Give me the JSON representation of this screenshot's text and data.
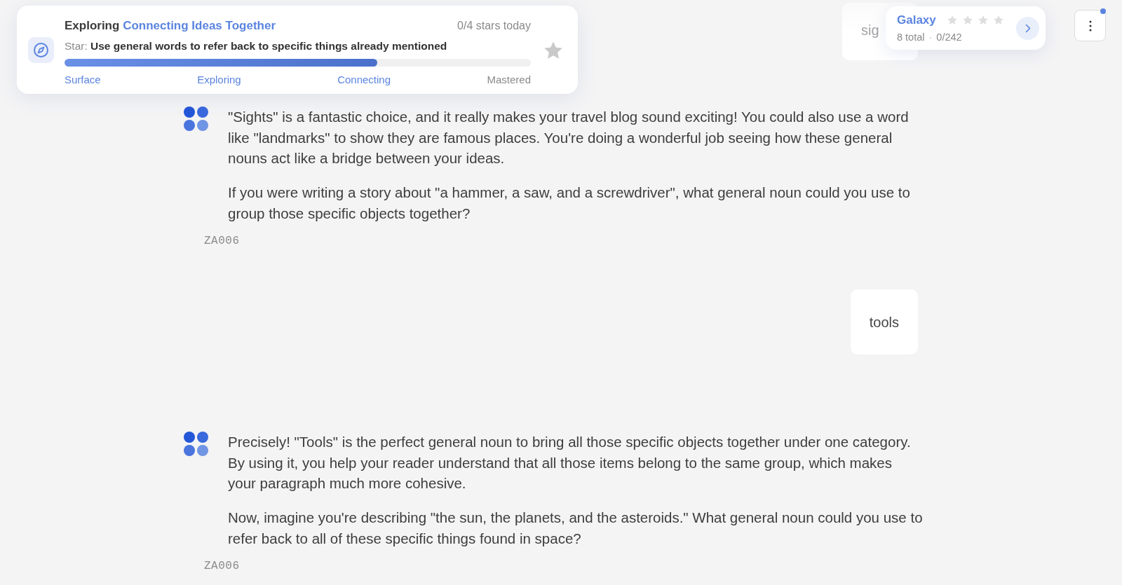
{
  "progress_card": {
    "stage": "Exploring",
    "topic": "Connecting Ideas Together",
    "stars_today": "0/4 stars today",
    "star_prefix": "Star:",
    "star_goal": "Use general words to refer back to specific things already mentioned",
    "level": 0.67,
    "stages": [
      {
        "label": "Surface",
        "reached": true
      },
      {
        "label": "Exploring",
        "reached": true
      },
      {
        "label": "Connecting",
        "reached": true
      },
      {
        "label": "Mastered",
        "reached": false
      }
    ],
    "star_earned": false
  },
  "galaxy": {
    "title": "Galaxy",
    "stars": 0,
    "total": "8 total",
    "separator": "·",
    "count": "0/242"
  },
  "menu": {
    "notification": true
  },
  "messages": [
    {
      "kind": "user",
      "text": "sig",
      "faded": true
    },
    {
      "kind": "assistant",
      "paragraphs": [
        "\"Sights\" is a fantastic choice, and it really makes your travel blog sound exciting! You could also use a word like \"landmarks\" to show they are famous places. You're doing a wonderful job seeing how these general nouns act like a bridge between your ideas.",
        "If you were writing a story about \"a hammer, a saw, and a screwdriver\", what general noun could you use to group those specific objects together?"
      ],
      "code": "ZA006"
    },
    {
      "kind": "user",
      "text": "tools",
      "faded": false
    },
    {
      "kind": "assistant",
      "paragraphs": [
        "Precisely! \"Tools\" is the perfect general noun to bring all those specific objects together under one category. By using it, you help your reader understand that all those items belong to the same group, which makes your paragraph much more cohesive.",
        "Now, imagine you're describing \"the sun, the planets, and the asteroids.\" What general noun could you use to refer back to all of these specific things found in space?"
      ],
      "code": "ZA006"
    }
  ]
}
